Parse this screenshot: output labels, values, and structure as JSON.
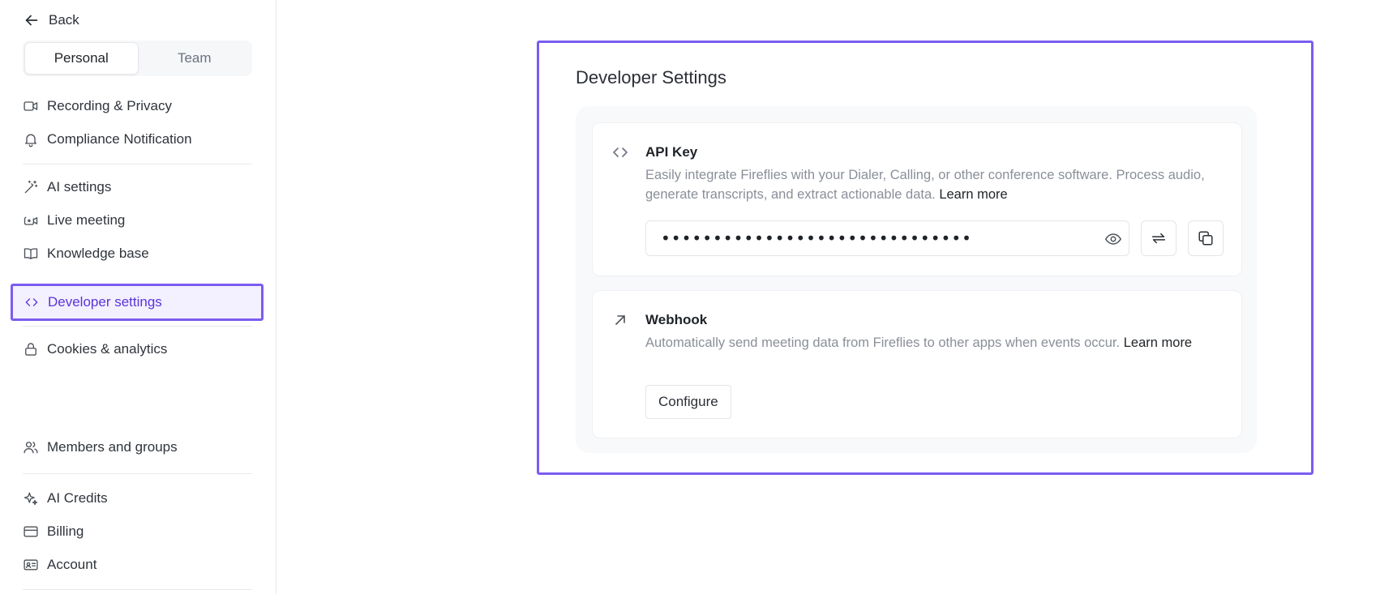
{
  "sidebar": {
    "back_label": "Back",
    "tabs": [
      {
        "label": "Personal",
        "active": true
      },
      {
        "label": "Team",
        "active": false
      }
    ],
    "items": [
      {
        "label": "Recording & Privacy",
        "icon": "video-icon"
      },
      {
        "label": "Compliance Notification",
        "icon": "bell-icon"
      },
      {
        "label": "AI settings",
        "icon": "magic-wand-icon"
      },
      {
        "label": "Live meeting",
        "icon": "live-video-icon"
      },
      {
        "label": "Knowledge base",
        "icon": "book-icon"
      },
      {
        "label": "Developer settings",
        "icon": "code-icon",
        "active": true
      },
      {
        "label": "Cookies & analytics",
        "icon": "lock-icon"
      },
      {
        "label": "Members and groups",
        "icon": "users-icon"
      },
      {
        "label": "AI Credits",
        "icon": "sparkle-icon"
      },
      {
        "label": "Billing",
        "icon": "credit-card-icon"
      },
      {
        "label": "Account",
        "icon": "id-card-icon"
      }
    ]
  },
  "main": {
    "title": "Developer Settings",
    "api_key": {
      "title": "API Key",
      "description": "Easily integrate Fireflies with your Dialer, Calling, or other conference software. Process audio, generate transcripts, and extract actionable data.",
      "link": "Learn more",
      "masked_value": "••••••••••••••••••••••••••••••"
    },
    "webhook": {
      "title": "Webhook",
      "description": "Automatically send meeting data from Fireflies to other apps when events occur.",
      "link": "Learn more",
      "button_label": "Configure"
    }
  },
  "colors": {
    "accent": "#7b5cf0",
    "accent_text": "#5b34d9",
    "muted_text": "#8a8f98"
  }
}
